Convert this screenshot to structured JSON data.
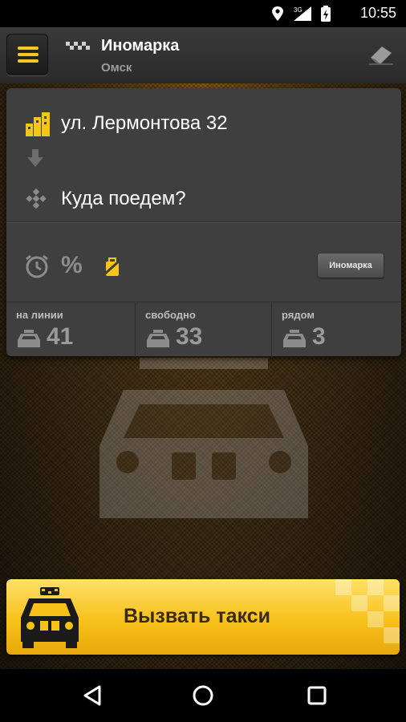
{
  "status_bar": {
    "time": "10:55",
    "network": "3G",
    "icons": [
      "location-icon",
      "signal-icon",
      "battery-icon"
    ]
  },
  "app_bar": {
    "title": "Иномарка",
    "city": "Омск",
    "menu_icon": "menu-icon",
    "logo_icon": "checker-icon",
    "clear_icon": "eraser-icon"
  },
  "route": {
    "from": "ул. Лермонтова 32",
    "to_placeholder": "Куда поедем?"
  },
  "options": {
    "percent_label": "%",
    "tariff_button": "Иномарка"
  },
  "stats": [
    {
      "label": "на линии",
      "value": "41"
    },
    {
      "label": "свободно",
      "value": "33"
    },
    {
      "label": "рядом",
      "value": "3"
    }
  ],
  "call_button": {
    "label": "Вызвать такси"
  },
  "colors": {
    "accent": "#f7c81e",
    "card": "#3f3f3f",
    "appbar": "#333333"
  }
}
